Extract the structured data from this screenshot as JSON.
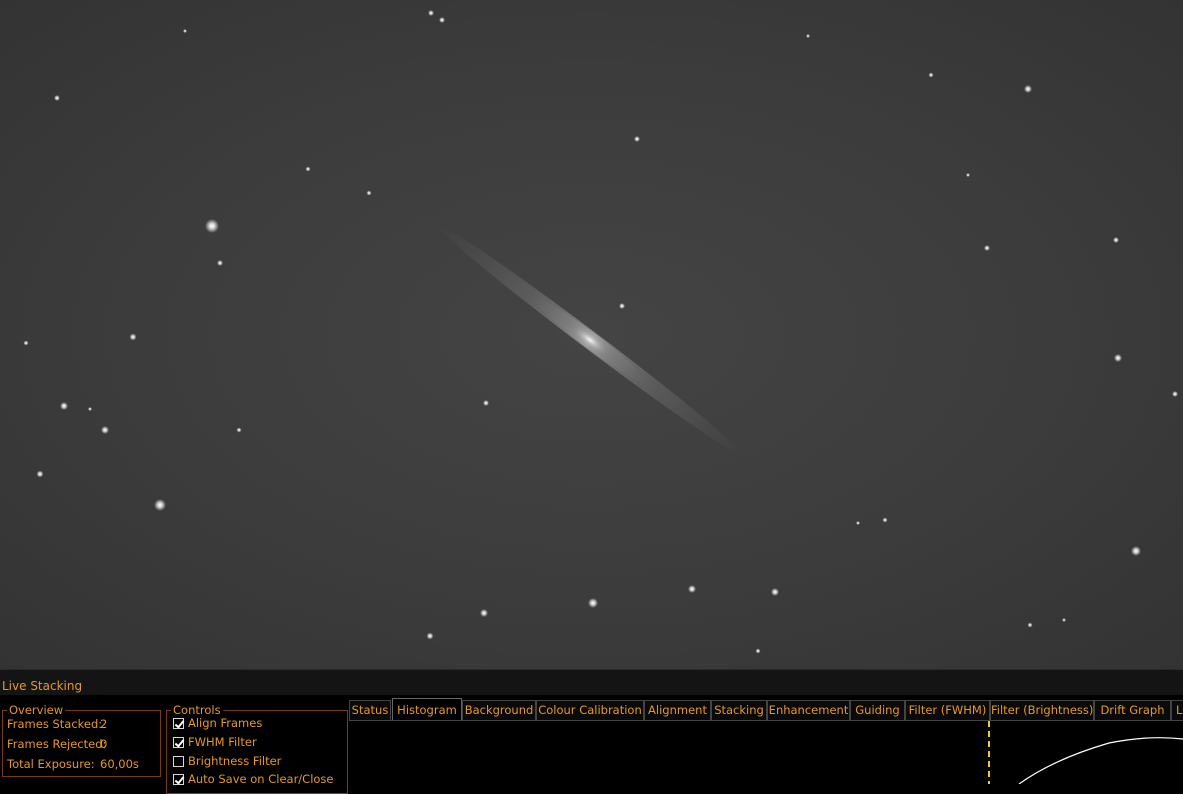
{
  "panel": {
    "title": "Live Stacking",
    "overview": {
      "legend": "Overview",
      "frames_stacked_label": "Frames Stacked:",
      "frames_stacked_value": "2",
      "frames_rejected_label": "Frames Rejected:",
      "frames_rejected_value": "0",
      "total_exposure_label": "Total Exposure:",
      "total_exposure_value": "60,00s"
    },
    "controls": {
      "legend": "Controls",
      "items": [
        {
          "label": "Align Frames",
          "checked": true
        },
        {
          "label": "FWHM Filter",
          "checked": true
        },
        {
          "label": "Brightness Filter",
          "checked": false
        },
        {
          "label": "Auto Save on Clear/Close",
          "checked": true
        }
      ]
    },
    "tabs": [
      "Status",
      "Histogram",
      "Background",
      "Colour Calibration",
      "Alignment",
      "Stacking",
      "Enhancement",
      "Guiding",
      "Filter (FWHM)",
      "Filter (Brightness)",
      "Drift Graph",
      "Log"
    ],
    "active_tab": "Histogram"
  },
  "colors": {
    "accent": "#e8962a",
    "sky": "#3e3e3e",
    "marker": "#f0d020"
  }
}
